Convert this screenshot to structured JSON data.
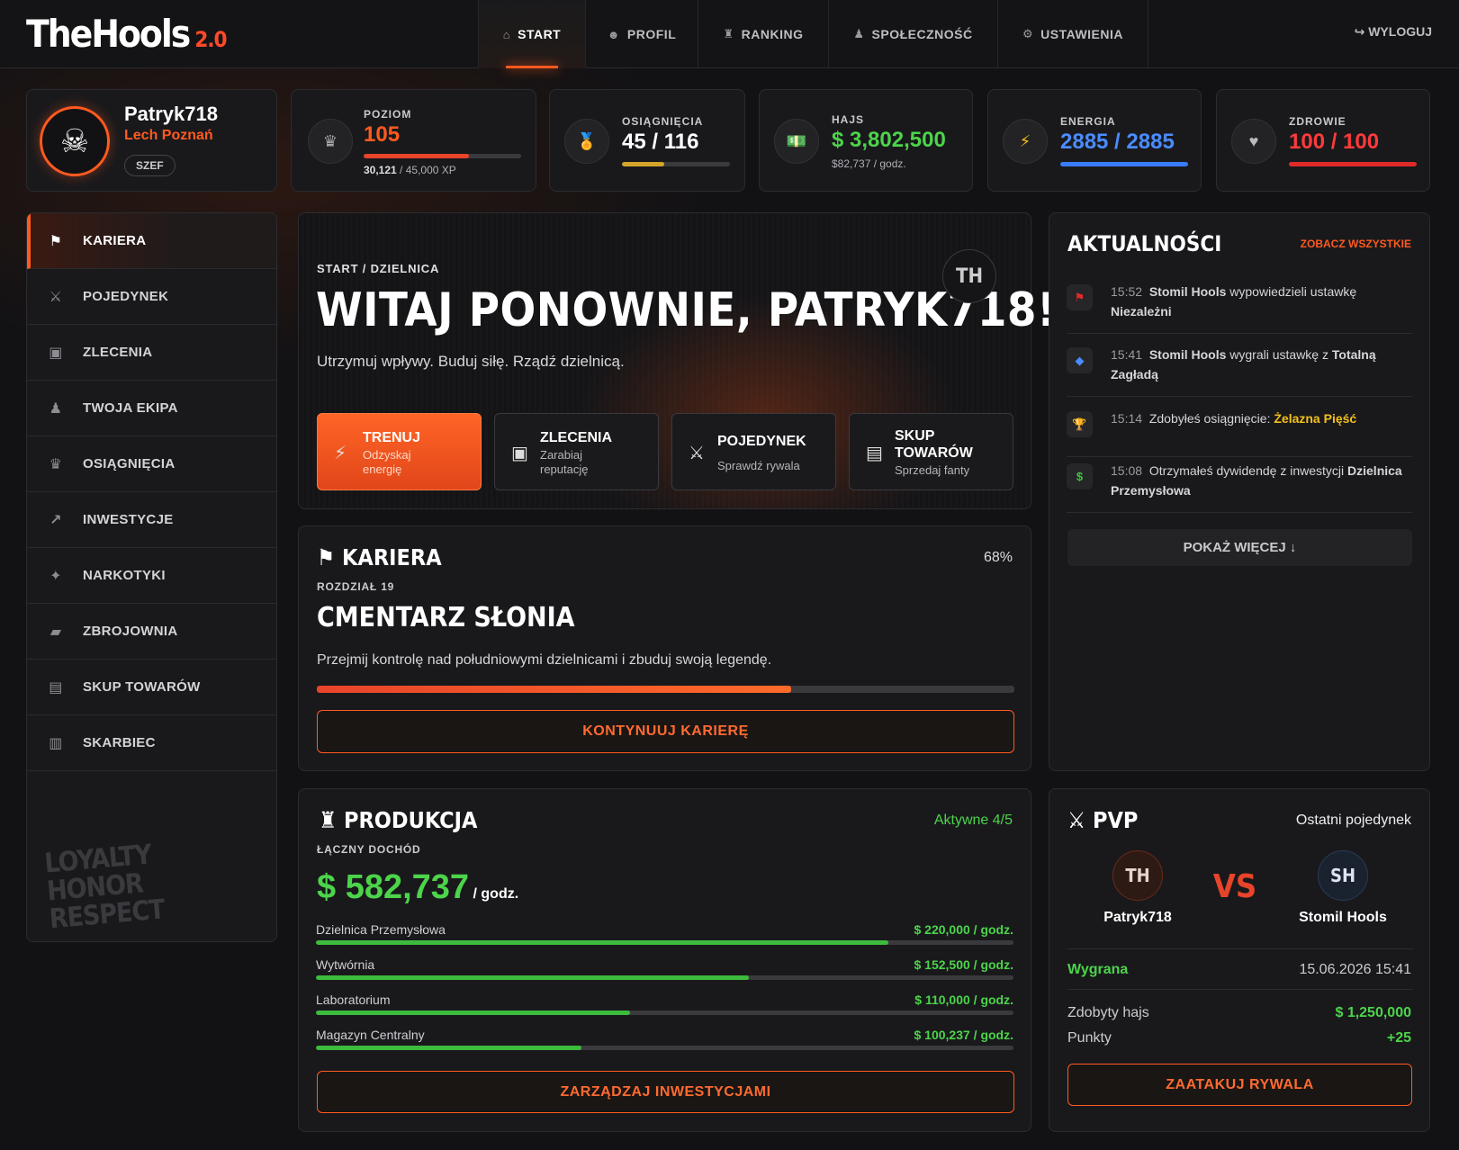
{
  "app": {
    "logo": "TheHools",
    "version": "2.0"
  },
  "nav": {
    "tabs": [
      {
        "icon": "⌂",
        "label": "START"
      },
      {
        "icon": "☻",
        "label": "PROFIL"
      },
      {
        "icon": "♜",
        "label": "RANKING"
      },
      {
        "icon": "♟",
        "label": "SPOŁECZNOŚĆ"
      },
      {
        "icon": "⚙",
        "label": "USTAWIENIA"
      }
    ],
    "logout": "↪ WYLOGUJ"
  },
  "profile": {
    "name": "Patryk718",
    "club": "Lech Poznań",
    "rank": "SZEF"
  },
  "stats": {
    "level": {
      "label": "POZIOM",
      "value": "105",
      "xp": "30,121",
      "xp_max": "/ 45,000 XP",
      "progress": 0.67
    },
    "achievements": {
      "label": "OSIĄGNIĘCIA",
      "value": "45 / 116",
      "progress": 0.39
    },
    "money": {
      "label": "HAJS",
      "value": "$ 3,802,500",
      "rate": "$82,737 / godz."
    },
    "energy": {
      "label": "ENERGIA",
      "value": "2885 / 2885",
      "progress": 1.0
    },
    "health": {
      "label": "ZDROWIE",
      "value": "100 / 100",
      "progress": 1.0
    }
  },
  "sidebar": {
    "items": [
      {
        "icon": "⚑",
        "label": "KARIERA"
      },
      {
        "icon": "⚔",
        "label": "POJEDYNEK"
      },
      {
        "icon": "▣",
        "label": "ZLECENIA"
      },
      {
        "icon": "♟",
        "label": "TWOJA EKIPA"
      },
      {
        "icon": "♛",
        "label": "OSIĄGNIĘCIA"
      },
      {
        "icon": "↗",
        "label": "INWESTYCJE"
      },
      {
        "icon": "✦",
        "label": "NARKOTYKI"
      },
      {
        "icon": "▰",
        "label": "ZBROJOWNIA"
      },
      {
        "icon": "▤",
        "label": "SKUP TOWARÓW"
      },
      {
        "icon": "▥",
        "label": "SKARBIEC"
      }
    ],
    "motto": "LOYALTY\nHONOR\nRESPECT"
  },
  "hero": {
    "breadcrumb": "START / DZIELNICA",
    "title": "WITAJ PONOWNIE, PATRYK718!",
    "subtitle": "Utrzymuj wpływy. Buduj siłę. Rządź dzielnicą.",
    "badge": "TH",
    "actions": [
      {
        "icon": "⚡",
        "title": "TRENUJ",
        "desc": "Odzyskaj energię"
      },
      {
        "icon": "▣",
        "title": "ZLECENIA",
        "desc": "Zarabiaj reputację"
      },
      {
        "icon": "⚔",
        "title": "POJEDYNEK",
        "desc": "Sprawdź rywala"
      },
      {
        "icon": "▤",
        "title": "SKUP TOWARÓW",
        "desc": "Sprzedaj fanty"
      }
    ]
  },
  "career": {
    "heading": "KARIERA",
    "percent": "68%",
    "progress": 0.68,
    "chapter": "ROZDZIAŁ 19",
    "title": "CMENTARZ SŁONIA",
    "desc": "Przejmij kontrolę nad południowymi dzielnicami i zbuduj swoją legendę.",
    "button": "KONTYNUUJ KARIERĘ"
  },
  "production": {
    "heading": "PRODUKCJA",
    "active": "Aktywne 4/5",
    "income_label": "ŁĄCZNY DOCHÓD",
    "income": "$ 582,737",
    "income_unit": "/ godz.",
    "rows": [
      {
        "name": "Dzielnica Przemysłowa",
        "value": "$ 220,000 / godz.",
        "progress": 0.82
      },
      {
        "name": "Wytwórnia",
        "value": "$ 152,500 / godz.",
        "progress": 0.62
      },
      {
        "name": "Laboratorium",
        "value": "$ 110,000 / godz.",
        "progress": 0.45
      },
      {
        "name": "Magazyn Centralny",
        "value": "$ 100,237 / godz.",
        "progress": 0.38
      }
    ],
    "button": "ZARZĄDZAJ INWESTYCJAMI"
  },
  "news": {
    "heading": "AKTUALNOŚCI",
    "see_all": "ZOBACZ WSZYSTKIE",
    "items": [
      {
        "icon": "⚑",
        "color": "#e02a2a",
        "time": "15:52",
        "parts": [
          "Stomil Hools",
          " wypowiedzieli ustawkę ",
          "Niezależni"
        ]
      },
      {
        "icon": "◆",
        "color": "#4a8cff",
        "time": "15:41",
        "parts": [
          "Stomil Hools",
          " wygrali ustawkę z ",
          "Totalną Zagładą"
        ]
      },
      {
        "icon": "🏆",
        "color": "#f2a51a",
        "time": "15:14",
        "parts": [
          "",
          "Zdobyłeś osiągnięcie: ",
          "Żelazna Pięść"
        ]
      },
      {
        "icon": "$",
        "color": "#3fc53f",
        "time": "15:08",
        "parts": [
          "",
          "Otrzymałeś dywidendę z inwestycji ",
          "Dzielnica Przemysłowa"
        ]
      }
    ],
    "more": "POKAŻ WIĘCEJ ↓"
  },
  "pvp": {
    "heading": "PVP",
    "last": "Ostatni pojedynek",
    "player1": {
      "badge": "TH",
      "name": "Patryk718"
    },
    "player2": {
      "badge": "SH",
      "name": "Stomil Hools"
    },
    "vs": "VS",
    "result": "Wygrana",
    "date": "15.06.2026 15:41",
    "money_label": "Zdobyty hajs",
    "money": "$ 1,250,000",
    "points_label": "Punkty",
    "points": "+25",
    "button": "ZAATAKUJ RYWALA"
  },
  "colors": {
    "accent": "#ff5a1f",
    "green": "#4cd44a",
    "blue": "#3a7cff",
    "red": "#e02a2a",
    "gold": "#d4a52a"
  }
}
